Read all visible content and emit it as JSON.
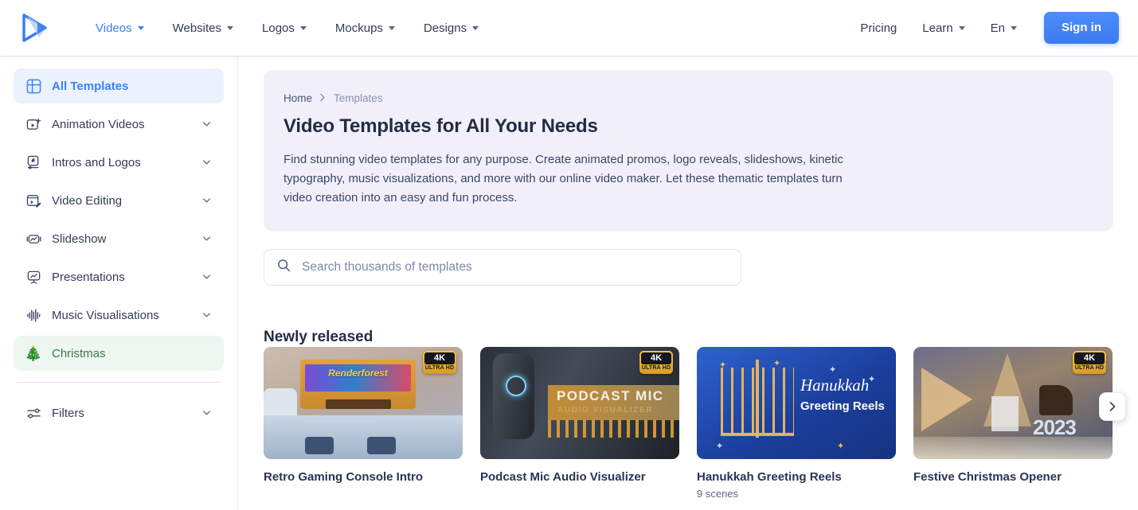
{
  "brand": {
    "logo_name": "renderforest-play-logo"
  },
  "header": {
    "nav": [
      {
        "label": "Videos",
        "active": true,
        "caret": true
      },
      {
        "label": "Websites",
        "active": false,
        "caret": true
      },
      {
        "label": "Logos",
        "active": false,
        "caret": true
      },
      {
        "label": "Mockups",
        "active": false,
        "caret": true
      },
      {
        "label": "Designs",
        "active": false,
        "caret": true
      }
    ],
    "right": [
      {
        "label": "Pricing",
        "caret": false
      },
      {
        "label": "Learn",
        "caret": true
      },
      {
        "label": "En",
        "caret": true
      }
    ],
    "signin_label": "Sign in"
  },
  "sidebar": {
    "items": [
      {
        "label": "All Templates",
        "icon": "grid-icon",
        "chevron": false,
        "state": "active-blue"
      },
      {
        "label": "Animation Videos",
        "icon": "video-plus-icon",
        "chevron": true,
        "state": ""
      },
      {
        "label": "Intros and Logos",
        "icon": "intro-logo-icon",
        "chevron": true,
        "state": ""
      },
      {
        "label": "Video Editing",
        "icon": "video-edit-icon",
        "chevron": true,
        "state": ""
      },
      {
        "label": "Slideshow",
        "icon": "slideshow-icon",
        "chevron": true,
        "state": ""
      },
      {
        "label": "Presentations",
        "icon": "presentation-icon",
        "chevron": true,
        "state": ""
      },
      {
        "label": "Music Visualisations",
        "icon": "waveform-icon",
        "chevron": true,
        "state": ""
      },
      {
        "label": "Christmas",
        "icon": "christmas-tree-icon",
        "chevron": false,
        "state": "active-green",
        "emoji": "🎄"
      }
    ],
    "filters": {
      "label": "Filters",
      "icon": "sliders-icon",
      "chevron": true
    }
  },
  "hero": {
    "breadcrumb": {
      "home": "Home",
      "separator": "›",
      "current": "Templates"
    },
    "title": "Video Templates for All Your Needs",
    "description": "Find stunning video templates for any purpose. Create animated promos, logo reveals, slideshows, kinetic typography, music visualizations, and more with our online video maker. Let these thematic templates turn video creation into an easy and fun process."
  },
  "search": {
    "placeholder": "Search thousands of templates",
    "value": "",
    "icon": "search-icon"
  },
  "section": {
    "title": "Newly released",
    "next_arrow": "›"
  },
  "badge": {
    "top": "4K",
    "bottom": "ULTRA HD"
  },
  "cards": [
    {
      "title": "Retro Gaming Console Intro",
      "subtitle": "",
      "badge": true,
      "art_text": "Renderforest"
    },
    {
      "title": "Podcast Mic Audio Visualizer",
      "subtitle": "",
      "badge": true,
      "art_text": "PODCAST MIC",
      "art_sub": "AUDIO VISUALIZER"
    },
    {
      "title": "Hanukkah Greeting Reels",
      "subtitle": "9 scenes",
      "badge": false,
      "art_text": "Hanukkah",
      "art_sub": "Greeting Reels"
    },
    {
      "title": "Festive Christmas Opener",
      "subtitle": "",
      "badge": true,
      "art_text": "2023"
    }
  ],
  "colors": {
    "accent_blue": "#3b82f6",
    "hero_bg": "#f1f0fa",
    "active_blue_bg": "#ebf2fe",
    "active_green_bg": "#edf6ef",
    "active_green_text": "#3b7a47",
    "text_dark": "#232b45"
  }
}
